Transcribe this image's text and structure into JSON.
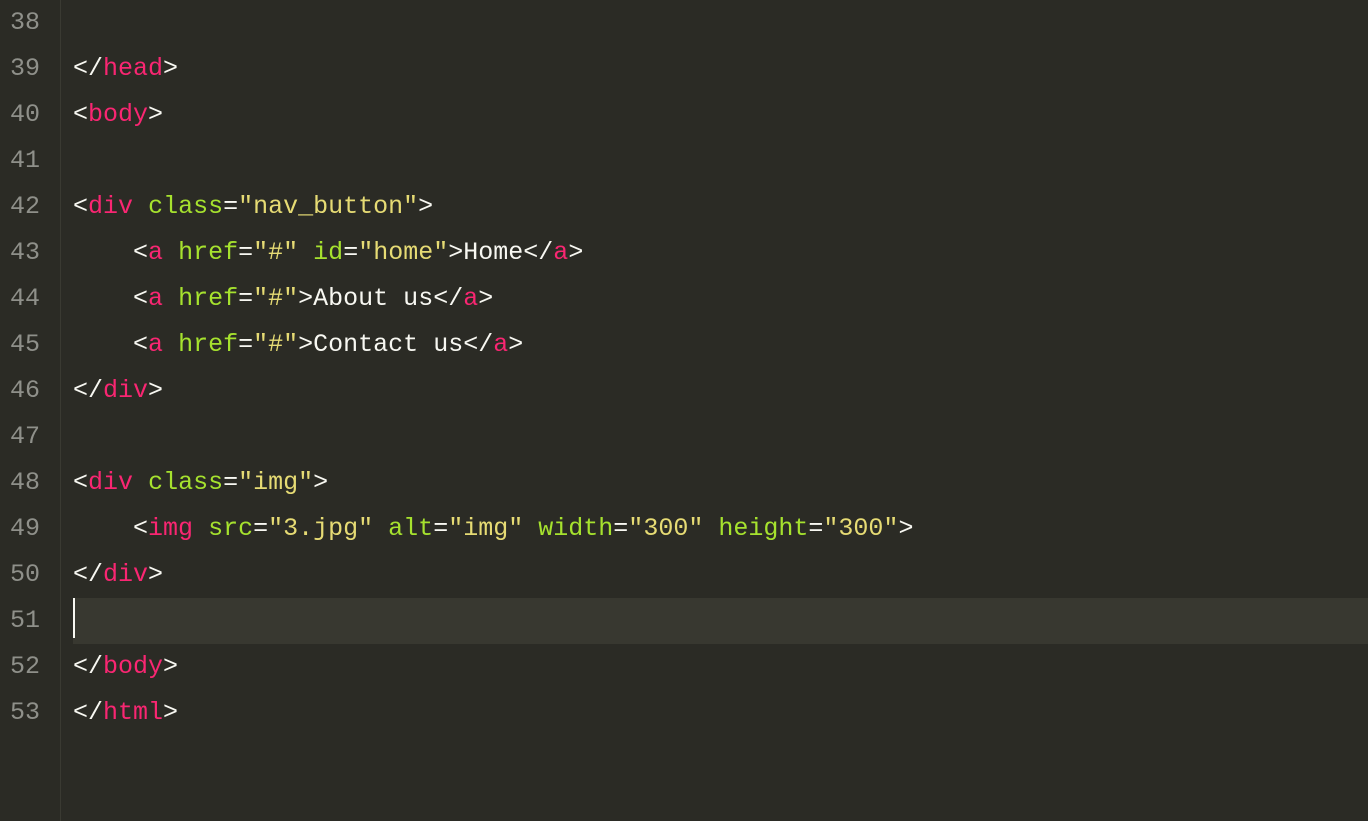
{
  "lineNumbers": [
    "38",
    "39",
    "40",
    "41",
    "42",
    "43",
    "44",
    "45",
    "46",
    "47",
    "48",
    "49",
    "50",
    "51",
    "52",
    "53"
  ],
  "code": {
    "l38": "",
    "l39": {
      "closeTag": "head"
    },
    "l40": {
      "openTag": "body"
    },
    "l41": "",
    "l42": {
      "openTag": "div",
      "attrs": [
        {
          "name": "class",
          "value": "nav_button"
        }
      ]
    },
    "l43": {
      "indent": "    ",
      "openTag": "a",
      "attrs": [
        {
          "name": "href",
          "value": "#"
        },
        {
          "name": "id",
          "value": "home"
        }
      ],
      "text": "Home",
      "closeTag": "a"
    },
    "l44": {
      "indent": "    ",
      "openTag": "a",
      "attrs": [
        {
          "name": "href",
          "value": "#"
        }
      ],
      "text": "About us",
      "closeTag": "a"
    },
    "l45": {
      "indent": "    ",
      "openTag": "a",
      "attrs": [
        {
          "name": "href",
          "value": "#"
        }
      ],
      "text": "Contact us",
      "closeTag": "a"
    },
    "l46": {
      "closeTag": "div"
    },
    "l47": "",
    "l48": {
      "openTag": "div",
      "attrs": [
        {
          "name": "class",
          "value": "img"
        }
      ]
    },
    "l49": {
      "indent": "    ",
      "openTag": "img",
      "attrs": [
        {
          "name": "src",
          "value": "3.jpg"
        },
        {
          "name": "alt",
          "value": "img"
        },
        {
          "name": "width",
          "value": "300"
        },
        {
          "name": "height",
          "value": "300"
        }
      ],
      "selfclose": true
    },
    "l50": {
      "closeTag": "div"
    },
    "l51": {
      "cursor": true
    },
    "l52": {
      "closeTag": "body"
    },
    "l53": {
      "closeTag": "html"
    }
  }
}
